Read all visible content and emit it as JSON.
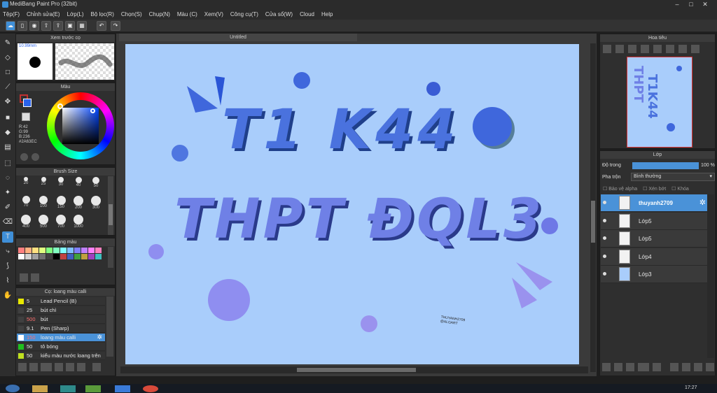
{
  "app": {
    "title": "MediBang Paint Pro (32bit)"
  },
  "menu": [
    "Tệp(F)",
    "Chỉnh sửa(E)",
    "Lớp(L)",
    "Bộ lọc(R)",
    "Chọn(S)",
    "Chụp(N)",
    "Màu (C)",
    "Xem(V)",
    "Công cụ(T)",
    "Cửa sổ(W)",
    "Cloud",
    "Help"
  ],
  "canvas": {
    "tab_title": "Untitled",
    "line1": "T1 K44",
    "line2": "THPT ĐQL3",
    "signature_line1": "THUYANH2709",
    "signature_line2": "@ALGART"
  },
  "brush_preview": {
    "title": "Xem trước cọ",
    "size": "10.99mm"
  },
  "color_panel": {
    "title": "Màu",
    "r": "R:42",
    "g": "G:99",
    "b": "B:236",
    "hex": "#2A63EC",
    "primary": "#2a63ec",
    "secondary": "#c03030"
  },
  "brush_size": {
    "title": "Brush Size",
    "sizes": [
      "20",
      "25",
      "30",
      "40",
      "50",
      "70",
      "100",
      "150",
      "200",
      "300",
      "400",
      "500",
      "700",
      "1000"
    ]
  },
  "palette": {
    "title": "Bảng màu",
    "colors": [
      "#ff8080",
      "#ffb080",
      "#ffe080",
      "#e0ff80",
      "#80ff80",
      "#80ffc0",
      "#80ffff",
      "#80c0ff",
      "#8080ff",
      "#c080ff",
      "#ff80ff",
      "#ff80c0",
      "#ffffff",
      "#d0d0d0",
      "#a0a0a0",
      "#707070",
      "#404040",
      "#000000",
      "#c04040",
      "#4060c0",
      "#40a040",
      "#c0a040",
      "#a040c0",
      "#40c0c0"
    ]
  },
  "brush_list": {
    "title": "Cọ: loang màu calli",
    "items": [
      {
        "swatch": "#e8e800",
        "size": "5",
        "name": "Lead Pencil (B)"
      },
      {
        "swatch": "#404040",
        "size": "25",
        "name": "bút chì"
      },
      {
        "swatch": "#404040",
        "size": "500",
        "name": "bút"
      },
      {
        "swatch": "#404040",
        "size": "9.1",
        "name": "Pen (Sharp)"
      },
      {
        "swatch": "#ffffff",
        "size": "150",
        "name": "loang màu calli"
      },
      {
        "swatch": "#20c020",
        "size": "50",
        "name": "tô bóng"
      },
      {
        "swatch": "#c0e020",
        "size": "50",
        "name": "kiểu màu nước loang trên"
      }
    ]
  },
  "navigator": {
    "title": "Hoa tiêu"
  },
  "layers": {
    "title": "Lớp",
    "opacity_label": "Độ trong",
    "opacity_value": "100 %",
    "blend_label": "Pha trộn",
    "blend_value": "Bình thường",
    "protect_alpha": "Bảo vệ alpha",
    "clipping": "Xén bớt",
    "lock": "Khóa",
    "items": [
      {
        "name": "thuyanh2709",
        "selected": true
      },
      {
        "name": "Lớp5",
        "selected": false
      },
      {
        "name": "Lớp5",
        "selected": false
      },
      {
        "name": "Lớp4",
        "selected": false
      },
      {
        "name": "Lớp3",
        "selected": false
      }
    ]
  },
  "taskbar": {
    "time": "17:27"
  }
}
